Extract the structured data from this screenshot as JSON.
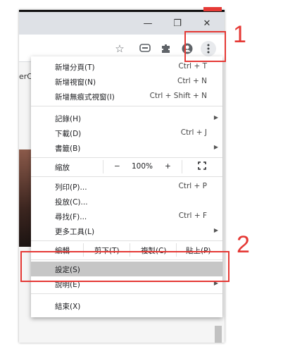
{
  "window": {
    "controls": {
      "minimize": "—",
      "restore": "❐",
      "close": "✕"
    },
    "page_text": "erC"
  },
  "toolbar": {
    "icons": [
      "star-icon",
      "chat-icon",
      "extension-icon",
      "profile-icon",
      "more-icon"
    ]
  },
  "menu": {
    "new_tab": {
      "label": "新增分頁(T)",
      "shortcut": "Ctrl + T"
    },
    "new_window": {
      "label": "新增視窗(N)",
      "shortcut": "Ctrl + N"
    },
    "incognito": {
      "label": "新增無痕式視窗(I)",
      "shortcut": "Ctrl + Shift + N"
    },
    "history": {
      "label": "記錄(H)"
    },
    "downloads": {
      "label": "下載(D)",
      "shortcut": "Ctrl + J"
    },
    "bookmarks": {
      "label": "書籤(B)"
    },
    "zoom": {
      "label": "縮放",
      "minus": "−",
      "value": "100%",
      "plus": "+"
    },
    "print": {
      "label": "列印(P)...",
      "shortcut": "Ctrl + P"
    },
    "cast": {
      "label": "投放(C)..."
    },
    "find": {
      "label": "尋找(F)...",
      "shortcut": "Ctrl + F"
    },
    "more_tools": {
      "label": "更多工具(L)"
    },
    "edit": {
      "label": "編輯",
      "cut": "剪下(T)",
      "copy": "複製(C)",
      "paste": "貼上(P)"
    },
    "settings": {
      "label": "設定(S)"
    },
    "help": {
      "label": "說明(E)"
    },
    "exit": {
      "label": "結束(X)"
    }
  },
  "annotations": {
    "step1": "1",
    "step2": "2"
  },
  "colors": {
    "annotation_red": "#e53935",
    "menu_highlight": "#c6c6c6",
    "titlebar": "#dee1e6"
  }
}
